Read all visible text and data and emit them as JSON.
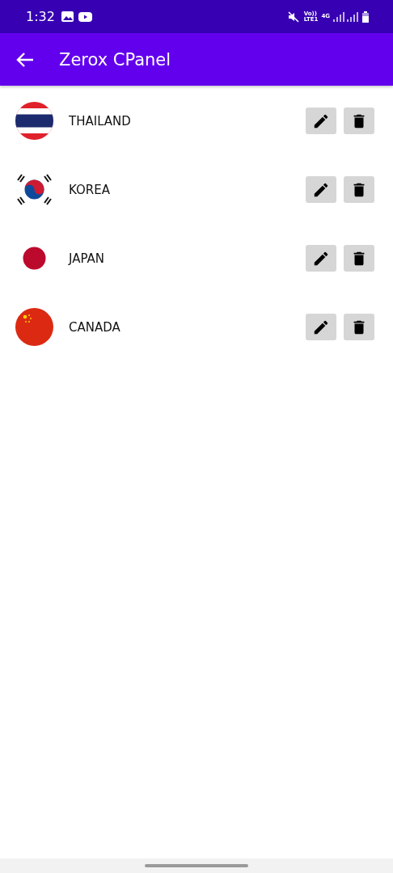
{
  "status_bar": {
    "time": "1:32",
    "volte": "Vo))",
    "lte": "LTE1",
    "network": "4G"
  },
  "app_bar": {
    "title": "Zerox CPanel"
  },
  "countries": [
    {
      "name": "THAILAND",
      "kind": "thai"
    },
    {
      "name": "KOREA",
      "kind": "korean"
    },
    {
      "name": "JAPAN",
      "kind": "japanese"
    },
    {
      "name": "CANADA",
      "kind": "chinese"
    }
  ]
}
